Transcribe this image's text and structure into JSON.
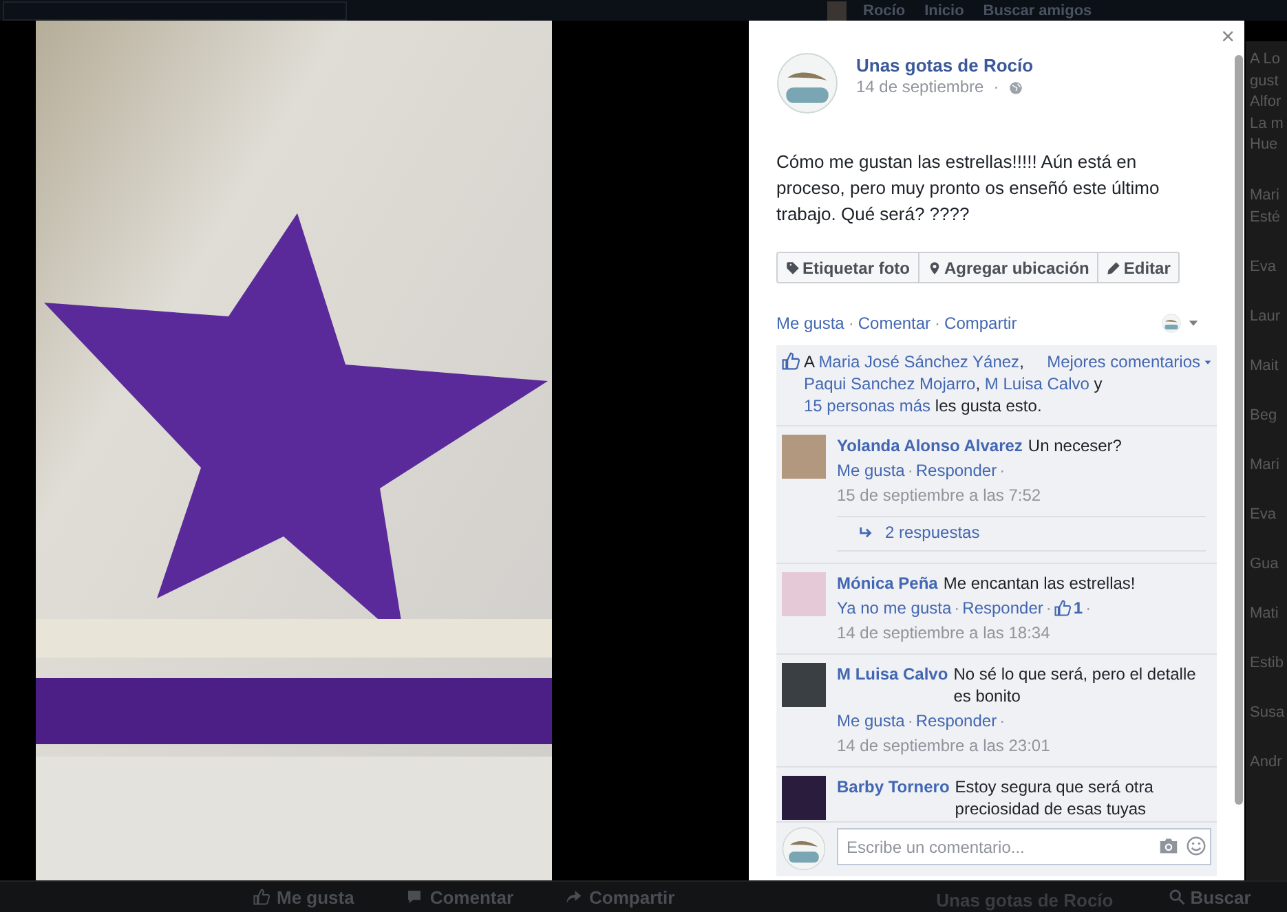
{
  "top_bar": {
    "items": [
      "Rocío",
      "Inicio",
      "Buscar amigos"
    ]
  },
  "sidebar_right": [
    {
      "lines": [
        "A Lo",
        "gust",
        "Alfor",
        "La m",
        "Hue"
      ]
    },
    {
      "lines": [
        "Mari",
        "Esté"
      ]
    },
    {
      "lines": [
        "Eva"
      ]
    },
    {
      "lines": [
        "Laur"
      ]
    },
    {
      "lines": [
        "Mait"
      ]
    },
    {
      "lines": [
        "Beg"
      ]
    },
    {
      "lines": [
        "Mari"
      ]
    },
    {
      "lines": [
        "Eva"
      ]
    },
    {
      "lines": [
        "Gua"
      ]
    },
    {
      "lines": [
        "Mati"
      ]
    },
    {
      "lines": [
        "Estib"
      ]
    },
    {
      "lines": [
        "Susa"
      ]
    },
    {
      "lines": [
        "Andr"
      ]
    }
  ],
  "bottom_bar": {
    "actions": [
      "Me gusta",
      "Comentar",
      "Compartir"
    ],
    "page_name": "Unas gotas de Rocío",
    "search": "Buscar"
  },
  "viewer": {
    "close": "×",
    "separator": "·",
    "post": {
      "author": "Unas gotas de Rocío",
      "date": "14 de septiembre",
      "text": "Cómo me gustan las estrellas!!!!! Aún está en proceso, pero muy pronto os enseñó este último trabajo. Qué será? ????",
      "buttons": [
        "Etiquetar foto",
        "Agregar ubicación",
        "Editar"
      ],
      "actions": [
        "Me gusta",
        "Comentar",
        "Compartir"
      ]
    },
    "likes": {
      "sort": "Mejores comentarios",
      "segments": [
        {
          "text": "A ",
          "link": false
        },
        {
          "text": "Maria José Sánchez Yánez",
          "link": true
        },
        {
          "text": ", ",
          "link": false
        },
        {
          "text": "Paqui Sanchez Mojarro",
          "link": true
        },
        {
          "text": ", ",
          "link": false
        },
        {
          "text": "M Luisa Calvo",
          "link": true
        },
        {
          "text": " y ",
          "link": false
        },
        {
          "text": "15 personas más",
          "link": true
        },
        {
          "text": " les gusta esto.",
          "link": false
        }
      ]
    },
    "comments": [
      {
        "author": "Yolanda Alonso Alvarez",
        "text": "Un neceser?",
        "actions": [
          {
            "text": "Me gusta",
            "kind": "link"
          },
          {
            "text": "Responder",
            "kind": "link"
          },
          {
            "text": "15 de septiembre a las 7:52",
            "kind": "time"
          }
        ],
        "replies": "2 respuestas"
      },
      {
        "author": "Mónica Peña",
        "text": "Me encantan las estrellas!",
        "actions": [
          {
            "text": "Ya no me gusta",
            "kind": "link"
          },
          {
            "text": "Responder",
            "kind": "link"
          },
          {
            "text": "1",
            "kind": "likes"
          },
          {
            "text": "14 de septiembre a las 18:34",
            "kind": "time"
          }
        ]
      },
      {
        "author": "M Luisa Calvo",
        "text": "No sé lo que será, pero el detalle es bonito",
        "actions": [
          {
            "text": "Me gusta",
            "kind": "link"
          },
          {
            "text": "Responder",
            "kind": "link"
          },
          {
            "text": "14 de septiembre a las 23:01",
            "kind": "time"
          }
        ]
      },
      {
        "author": "Barby Tornero",
        "text": "Estoy segura que será otra preciosidad de esas tuyas"
      }
    ],
    "comment_box": {
      "placeholder": "Escribe un comentario..."
    }
  }
}
